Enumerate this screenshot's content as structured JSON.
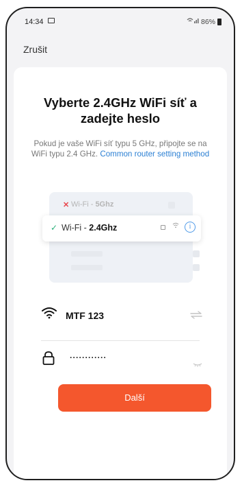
{
  "status_bar": {
    "time": "14:34",
    "battery": "86%"
  },
  "header": {
    "cancel_label": "Zrušit"
  },
  "main": {
    "title": "Vyberte 2.4GHz WiFi síť a zadejte heslo",
    "description": "Pokud je vaše WiFi síť typu 5 GHz, připojte se na WiFi typu 2.4 GHz.",
    "link": "Common router setting method"
  },
  "illustration": {
    "bad_prefix": "Wi-Fi - ",
    "bad_band": "5Ghz",
    "good_prefix": "Wi-Fi - ",
    "good_band": "2.4Ghz"
  },
  "wifi": {
    "ssid": "MTF 123"
  },
  "password": {
    "value": "············"
  },
  "button": {
    "next_label": "Další"
  },
  "colors": {
    "accent": "#f4572d",
    "link": "#2a7fd3",
    "success": "#2ab07a",
    "error": "#e8454b"
  },
  "icons": [
    "image-icon",
    "wifi-signal-icon",
    "battery-icon",
    "wifi-icon",
    "switch-icon",
    "lock-icon",
    "eye-closed-icon",
    "info-icon",
    "check-icon",
    "cross-icon"
  ]
}
